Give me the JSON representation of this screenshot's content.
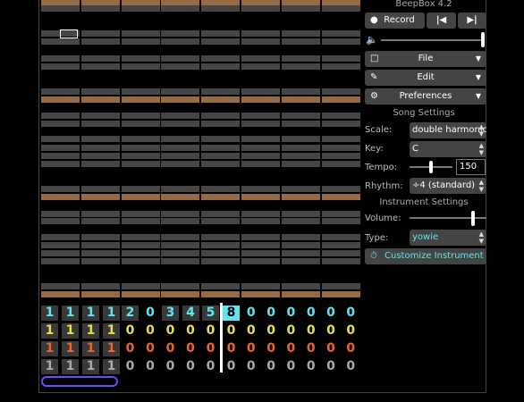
{
  "app": {
    "title": "BeepBox 4.2"
  },
  "toolbar": {
    "record_label": "Record",
    "record_icon": "record-dot-icon",
    "prev_icon": "skip-previous-icon",
    "next_icon": "skip-next-icon",
    "volume_icon": "volume-icon",
    "volume_level": 1.0
  },
  "menus": {
    "file_label": "File",
    "edit_label": "Edit",
    "preferences_label": "Preferences"
  },
  "song_settings": {
    "header": "Song Settings",
    "scale_label": "Scale:",
    "scale_value": "double harmonic :)",
    "key_label": "Key:",
    "key_value": "C",
    "tempo_label": "Tempo:",
    "tempo_value": "150",
    "rhythm_label": "Rhythm:",
    "rhythm_value": "÷4 (standard)"
  },
  "instrument_settings": {
    "header": "Instrument Settings",
    "volume_label": "Volume:",
    "volume_level": 0.9,
    "type_label": "Type:",
    "type_value": "yowie",
    "customize_label": "Customize Instrument"
  },
  "pattern_grid": {
    "channels": [
      {
        "color": "#5ee6f2",
        "cells": [
          "1",
          "1",
          "1",
          "1",
          "2",
          "0",
          "3",
          "4",
          "5",
          "8",
          "0",
          "0",
          "0",
          "0",
          "0",
          "0"
        ]
      },
      {
        "color": "#e8e04a",
        "cells": [
          "1",
          "1",
          "1",
          "1",
          "0",
          "0",
          "0",
          "0",
          "0",
          "0",
          "0",
          "0",
          "0",
          "0",
          "0",
          "0"
        ]
      },
      {
        "color": "#f0642a",
        "cells": [
          "1",
          "1",
          "1",
          "1",
          "0",
          "0",
          "0",
          "0",
          "0",
          "0",
          "0",
          "0",
          "0",
          "0",
          "0",
          "0"
        ]
      },
      {
        "color": "#aaaaaa",
        "cells": [
          "1",
          "1",
          "1",
          "1",
          "0",
          "0",
          "0",
          "0",
          "0",
          "0",
          "0",
          "0",
          "0",
          "0",
          "0",
          "0"
        ]
      }
    ],
    "selected_bar": 9
  },
  "colors": {
    "accent": "#5ee6f2",
    "octave_band": "#966a45",
    "note_band": "#464646",
    "scrollbar": "#7744ff"
  }
}
